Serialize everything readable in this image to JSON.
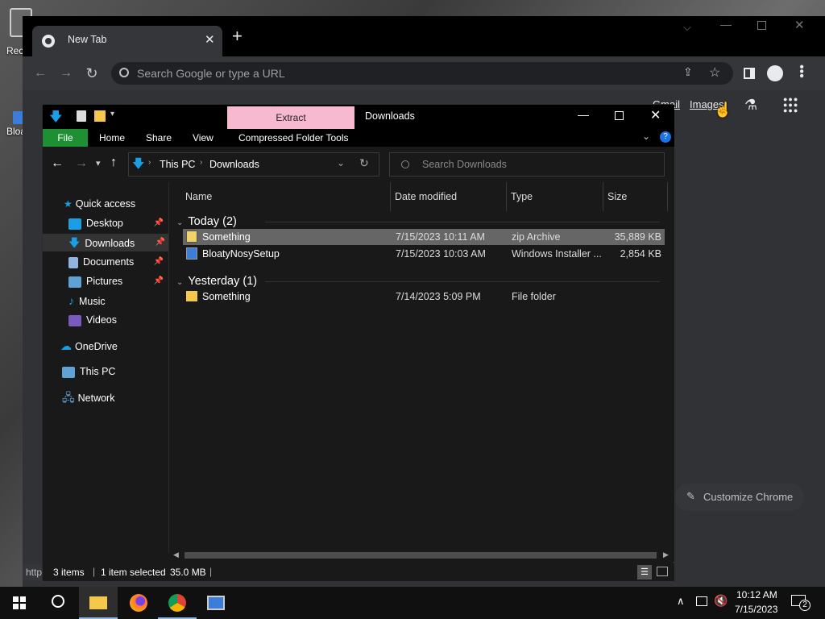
{
  "desktop": {
    "icons": [
      {
        "label": "Rec"
      },
      {
        "label": "Bloa"
      }
    ]
  },
  "chrome": {
    "tab_title": "New Tab",
    "new_tab_symbol": "+",
    "omnibox_placeholder": "Search Google or type a URL",
    "links": {
      "gmail": "Gmail",
      "images": "Images"
    },
    "customize_label": "Customize Chrome",
    "status_url": "http"
  },
  "explorer": {
    "title": "Downloads",
    "contextual_tab": "Extract",
    "ribbon_tabs": [
      "File",
      "Home",
      "Share",
      "View",
      "Compressed Folder Tools"
    ],
    "breadcrumb": [
      "This PC",
      "Downloads"
    ],
    "search_placeholder": "Search Downloads",
    "nav": {
      "quick_access": "Quick access",
      "items": [
        "Desktop",
        "Downloads",
        "Documents",
        "Pictures",
        "Music",
        "Videos"
      ],
      "onedrive": "OneDrive",
      "thispc": "This PC",
      "network": "Network"
    },
    "columns": [
      "Name",
      "Date modified",
      "Type",
      "Size"
    ],
    "groups": [
      {
        "label": "Today (2)",
        "files": [
          {
            "name": "Something",
            "date": "7/15/2023 10:11 AM",
            "type": "zip Archive",
            "size": "35,889 KB",
            "selected": true
          },
          {
            "name": "BloatyNosySetup",
            "date": "7/15/2023 10:03 AM",
            "type": "Windows Installer ...",
            "size": "2,854 KB",
            "selected": false
          }
        ]
      },
      {
        "label": "Yesterday (1)",
        "files": [
          {
            "name": "Something",
            "date": "7/14/2023 5:09 PM",
            "type": "File folder",
            "size": "",
            "selected": false
          }
        ]
      }
    ],
    "status": {
      "items": "3 items",
      "selected": "1 item selected",
      "size": "35.0 MB"
    }
  },
  "taskbar": {
    "time": "10:12 AM",
    "date": "7/15/2023",
    "notifications": "2"
  },
  "colors": {
    "accent": "#1a9fe6",
    "extract_tab": "#f7b9d0",
    "file_tab": "#1e8f33",
    "selected_row": "#666666"
  }
}
